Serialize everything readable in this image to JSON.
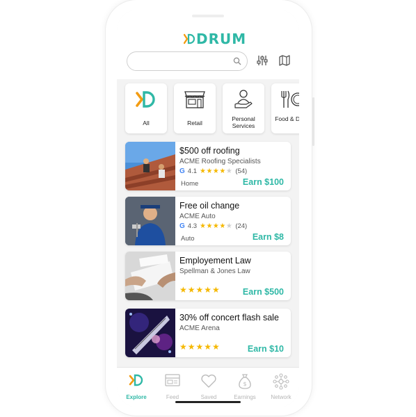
{
  "app": {
    "logo_text": "DRUM"
  },
  "search": {
    "placeholder": "",
    "value": ""
  },
  "toolbar": {
    "filter_icon": "sliders-icon",
    "map_icon": "map-icon"
  },
  "categories": [
    {
      "label": "All",
      "icon": "drum-logo-icon"
    },
    {
      "label": "Retail",
      "icon": "storefront-icon"
    },
    {
      "label": "Personal Services",
      "icon": "service-person-icon"
    },
    {
      "label": "Food & Drink",
      "icon": "plate-utensils-icon"
    }
  ],
  "offers": [
    {
      "title": "$500 off roofing",
      "business": "ACME Roofing Specialists",
      "rating": "4.1",
      "stars": 4,
      "reviews": "(54)",
      "category": "Home",
      "earn": "Earn $100"
    },
    {
      "title": "Free oil change",
      "business": "ACME Auto",
      "rating": "4.3",
      "stars": 4,
      "reviews": "(24)",
      "category": "Auto",
      "earn": "Earn $8"
    },
    {
      "title": "Employement Law",
      "business": "Spellman & Jones Law",
      "stars": 5,
      "earn": "Earn $500"
    },
    {
      "title": "30% off concert flash sale",
      "business": "ACME Arena",
      "stars": 5,
      "earn": "Earn $10"
    }
  ],
  "tabs": [
    {
      "label": "Explore",
      "icon": "drum-logo-icon",
      "active": true
    },
    {
      "label": "Feed",
      "icon": "feed-icon"
    },
    {
      "label": "Saved",
      "icon": "heart-icon"
    },
    {
      "label": "Earnings",
      "icon": "money-bag-icon"
    },
    {
      "label": "Network",
      "icon": "network-icon"
    }
  ],
  "colors": {
    "accent": "#2fb8a6",
    "logo_orange": "#f39c12",
    "star": "#f5b800"
  }
}
